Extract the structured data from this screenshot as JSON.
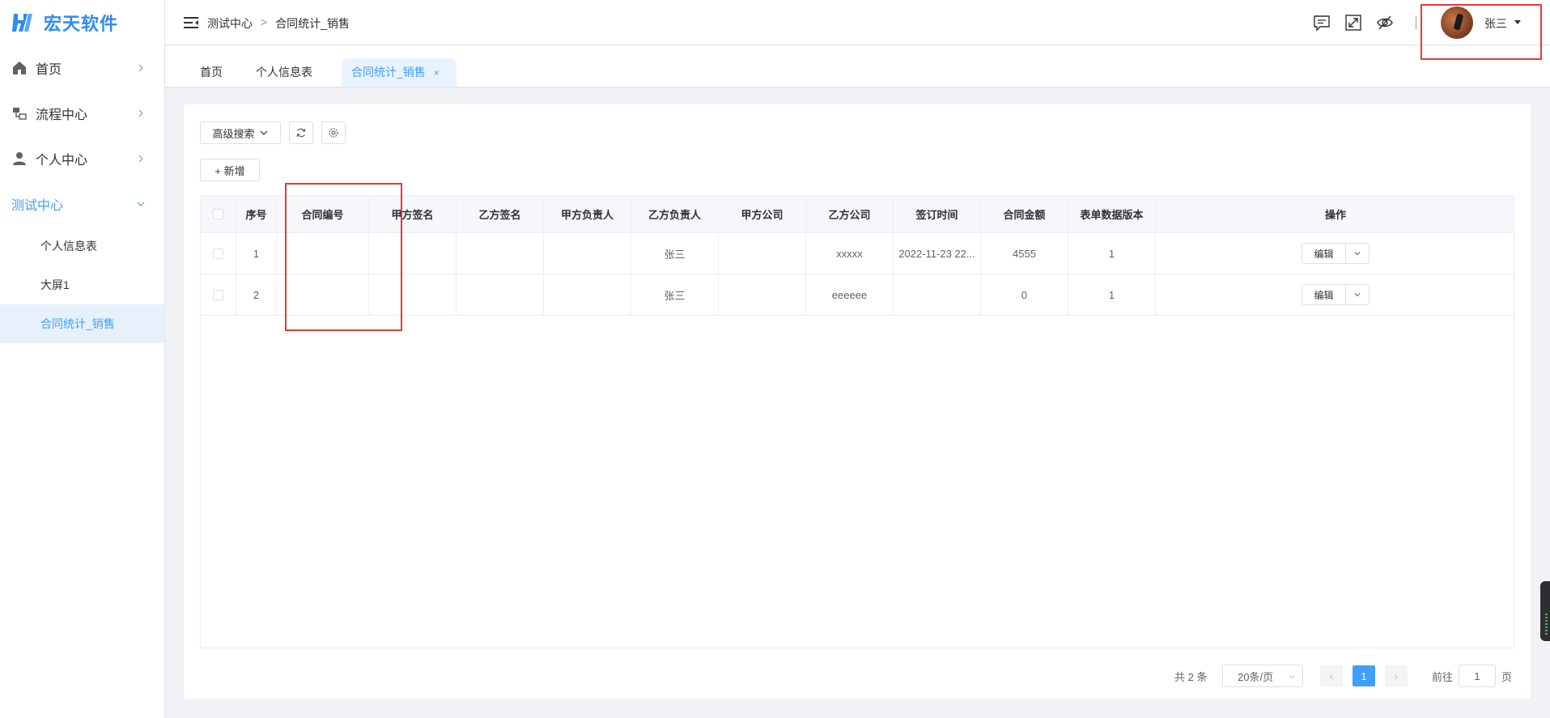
{
  "brand": {
    "name": "宏天软件",
    "color": "#2d8cf0"
  },
  "sidebar": {
    "items": [
      {
        "label": "首页",
        "icon": "home-icon"
      },
      {
        "label": "流程中心",
        "icon": "flow-icon"
      },
      {
        "label": "个人中心",
        "icon": "user-icon"
      },
      {
        "label": "测试中心",
        "icon": "",
        "open": true
      }
    ],
    "sub_items": [
      {
        "label": "个人信息表"
      },
      {
        "label": "大屏1"
      },
      {
        "label": "合同统计_销售",
        "active": true
      }
    ]
  },
  "header": {
    "breadcrumb": [
      "测试中心",
      "合同统计_销售"
    ],
    "breadcrumb_sep": ">",
    "username": "张三",
    "icons": [
      "message-icon",
      "fullscreen-icon",
      "eye-off-icon"
    ]
  },
  "tabs": [
    {
      "label": "首页"
    },
    {
      "label": "个人信息表"
    },
    {
      "label": "合同统计_销售",
      "active": true,
      "close": "×"
    }
  ],
  "toolbar": {
    "advanced_search": "高级搜索",
    "add": "+ 新增"
  },
  "table": {
    "columns": [
      "序号",
      "合同编号",
      "甲方签名",
      "乙方签名",
      "甲方负责人",
      "乙方负责人",
      "甲方公司",
      "乙方公司",
      "签订时间",
      "合同金额",
      "表单数据版本",
      "操作"
    ],
    "rows": [
      {
        "index": "1",
        "contract_no": "",
        "party_a_sign": "",
        "party_b_sign": "",
        "party_a_owner": "",
        "party_b_owner": "张三",
        "party_a_company": "",
        "party_b_company": "xxxxx",
        "sign_time": "2022-11-23 22...",
        "amount": "4555",
        "version": "1",
        "edit": "编辑"
      },
      {
        "index": "2",
        "contract_no": "",
        "party_a_sign": "",
        "party_b_sign": "",
        "party_a_owner": "",
        "party_b_owner": "张三",
        "party_a_company": "",
        "party_b_company": "eeeeee",
        "sign_time": "",
        "amount": "0",
        "version": "1",
        "edit": "编辑"
      }
    ]
  },
  "pagination": {
    "total": "共 2 条",
    "page_size": "20条/页",
    "current_page": "1",
    "goto_label": "前往",
    "goto_value": "1",
    "page_suffix": "页",
    "prev": "‹",
    "next": "›"
  },
  "colors": {
    "accent": "#409eff",
    "highlight": "#e53935"
  }
}
